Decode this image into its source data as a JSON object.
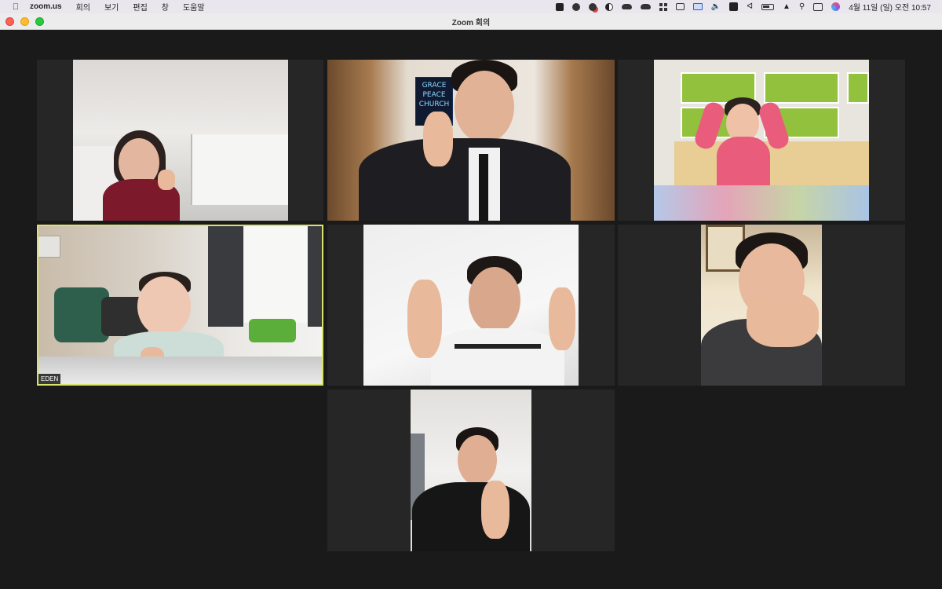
{
  "menubar": {
    "app": "zoom.us",
    "items": [
      "회의",
      "보기",
      "편집",
      "창",
      "도움말"
    ],
    "clock": "4월 11일 (일) 오전 10:57"
  },
  "window": {
    "title": "Zoom 회의"
  },
  "participants": [
    {
      "name": ""
    },
    {
      "name": ""
    },
    {
      "name": ""
    },
    {
      "name": "EDEN",
      "active_speaker": true
    },
    {
      "name": ""
    },
    {
      "name": ""
    },
    {
      "name": ""
    }
  ],
  "sign_text": "GRACE PEACE CHURCH"
}
